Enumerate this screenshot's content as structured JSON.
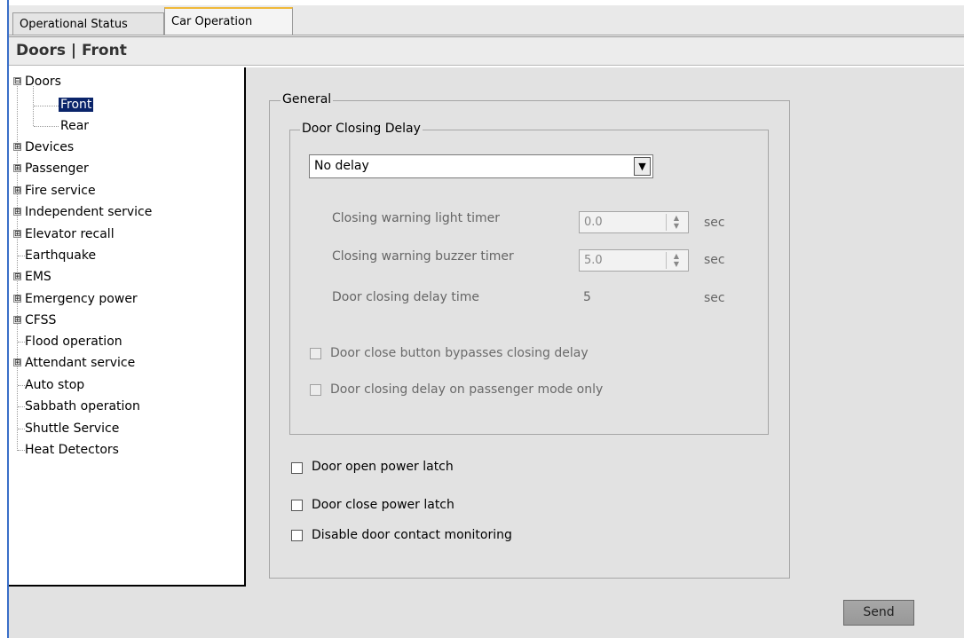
{
  "tabs": [
    {
      "label": "Operational Status",
      "active": false
    },
    {
      "label": "Car Operation",
      "active": true
    }
  ],
  "header": {
    "title": "Doors | Front"
  },
  "tree": {
    "items": [
      {
        "label": "Doors",
        "expander": "⊟"
      },
      {
        "label": "Front",
        "selected": true
      },
      {
        "label": "Rear"
      },
      {
        "label": "Devices",
        "expander": "⊞"
      },
      {
        "label": "Passenger",
        "expander": "⊞"
      },
      {
        "label": "Fire service",
        "expander": "⊞"
      },
      {
        "label": "Independent service",
        "expander": "⊞"
      },
      {
        "label": "Elevator recall",
        "expander": "⊞"
      },
      {
        "label": "Earthquake"
      },
      {
        "label": "EMS",
        "expander": "⊞"
      },
      {
        "label": "Emergency power",
        "expander": "⊞"
      },
      {
        "label": "CFSS",
        "expander": "⊞"
      },
      {
        "label": "Flood operation"
      },
      {
        "label": "Attendant service",
        "expander": "⊞"
      },
      {
        "label": "Auto stop"
      },
      {
        "label": "Sabbath operation"
      },
      {
        "label": "Shuttle Service"
      },
      {
        "label": "Heat Detectors"
      }
    ]
  },
  "general": {
    "legend": "General",
    "delay_group": {
      "legend": "Door Closing Delay",
      "select_value": "No delay",
      "light_timer_label": "Closing warning light timer",
      "light_timer_value": "0.0",
      "buzzer_timer_label": "Closing warning buzzer timer",
      "buzzer_timer_value": "5.0",
      "delay_time_label": "Door closing delay time",
      "delay_time_value": "5",
      "unit": "sec",
      "bypass_label": "Door close button bypasses closing delay",
      "passenger_only_label": "Door closing delay on passenger mode only"
    },
    "open_latch_label": "Door open power latch",
    "close_latch_label": "Door close power latch",
    "disable_monitoring_label": "Disable door contact monitoring"
  },
  "send_label": "Send",
  "colors": {
    "accent_tab": "#f0b93a",
    "selection": "#0a246a",
    "edge": "#3a6fc8"
  }
}
